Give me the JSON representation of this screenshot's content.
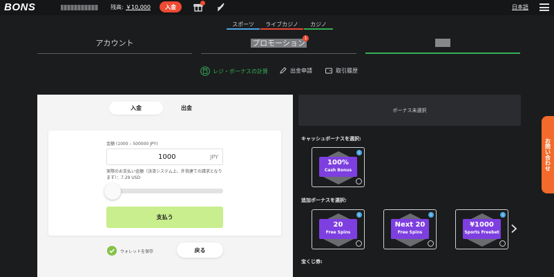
{
  "header": {
    "logo": "BONS",
    "balance_label": "残高:",
    "balance_value": "￥10,000",
    "deposit_button": "入金",
    "language": "日本語"
  },
  "categories": [
    {
      "label": "スポーツ",
      "color": "#4da8e8"
    },
    {
      "label": "ライブカジノ",
      "color": "#ee4a33"
    },
    {
      "label": "カジノ",
      "color": "#35b055"
    }
  ],
  "account_tabs": {
    "account": "アカウント",
    "promotions": "プロモーション",
    "promotions_badge": "1"
  },
  "subnav": {
    "cashier": "レジ・ボーナスの計算",
    "withdraw_request": "出金申請",
    "history": "取引履歴"
  },
  "payment": {
    "deposit_tab": "入金",
    "withdraw_tab": "出金",
    "amount_label": "金額 (1000 – 500000 JPY)",
    "amount_value": "1000",
    "amount_unit": "JPY",
    "note": "実際のお支払い金額（決済システム上、外貨建ての請求となります）：7.29 USD",
    "pay_button": "支払う",
    "save_wallet": "ウォレットを保存",
    "back_button": "戻る",
    "slider_level": 0
  },
  "bonus": {
    "none_selected": "ボーナス未選択",
    "cash_title": "キャッシュボーナスを選択:",
    "cash_items": [
      {
        "title": "100%",
        "subtitle": "Cash Bonus"
      }
    ],
    "extra_title": "追加ボーナスを選択:",
    "extra_items": [
      {
        "title": "20",
        "subtitle": "Free Spins"
      },
      {
        "title": "Next 20",
        "subtitle": "Free Spins"
      },
      {
        "title": "¥1000",
        "subtitle": "Sports Freebet"
      }
    ],
    "lottery_title": "宝くじ券:",
    "info_glyph": "i"
  },
  "contact_tab": "お問い合わせ",
  "colors": {
    "accent_green": "#35b055",
    "deposit_red": "#ee4a33",
    "bonus_purple": "#7d3fe0",
    "pay_button": "#c9ee8d",
    "contact_orange": "#f26b2a"
  }
}
